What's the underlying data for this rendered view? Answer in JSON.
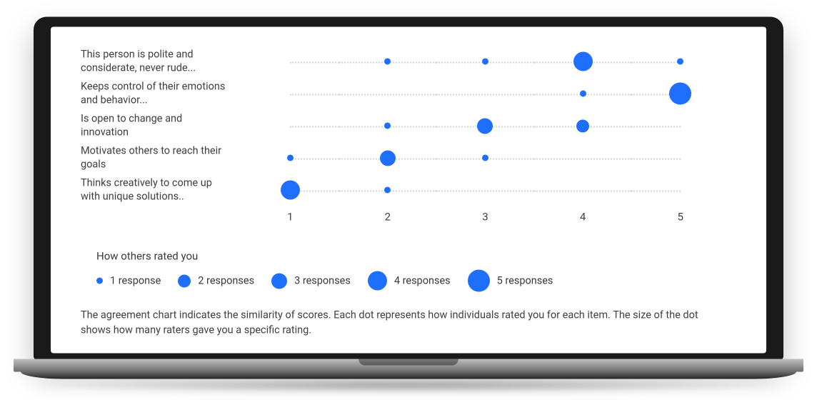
{
  "chart_data": {
    "type": "scatter",
    "xlabel": "",
    "ylabel": "",
    "x_ticks": [
      "1",
      "2",
      "3",
      "4",
      "5"
    ],
    "categories": [
      "This person is polite and considerate, never rude...",
      "Keeps control of their emotions and behavior...",
      "Is open to change and innovation",
      "Motivates others to reach their goals",
      "Thinks creatively to come up with unique solutions.."
    ],
    "series_meaning": "dot at (rating, category) with size = number of raters giving that rating",
    "points": [
      {
        "category_index": 0,
        "rating": 2,
        "responses": 1
      },
      {
        "category_index": 0,
        "rating": 3,
        "responses": 1
      },
      {
        "category_index": 0,
        "rating": 4,
        "responses": 4
      },
      {
        "category_index": 0,
        "rating": 5,
        "responses": 1
      },
      {
        "category_index": 1,
        "rating": 4,
        "responses": 1
      },
      {
        "category_index": 1,
        "rating": 5,
        "responses": 5
      },
      {
        "category_index": 2,
        "rating": 2,
        "responses": 1
      },
      {
        "category_index": 2,
        "rating": 3,
        "responses": 3
      },
      {
        "category_index": 2,
        "rating": 4,
        "responses": 2
      },
      {
        "category_index": 3,
        "rating": 1,
        "responses": 1
      },
      {
        "category_index": 3,
        "rating": 2,
        "responses": 3
      },
      {
        "category_index": 3,
        "rating": 3,
        "responses": 1
      },
      {
        "category_index": 4,
        "rating": 1,
        "responses": 4
      },
      {
        "category_index": 4,
        "rating": 2,
        "responses": 1
      }
    ],
    "size_scale": [
      1,
      2,
      3,
      4,
      5
    ]
  },
  "legend": {
    "title": "How others rated you",
    "items": [
      {
        "size": 1,
        "label": "1 response"
      },
      {
        "size": 2,
        "label": "2 responses"
      },
      {
        "size": 3,
        "label": "3 responses"
      },
      {
        "size": 4,
        "label": "4 responses"
      },
      {
        "size": 5,
        "label": "5 responses"
      }
    ]
  },
  "description": "The agreement chart indicates the similarity of scores. Each dot represents how individuals rated you for each item. The size of the dot shows how many raters gave you a specific rating.",
  "colors": {
    "dot": "#1f6fff"
  }
}
